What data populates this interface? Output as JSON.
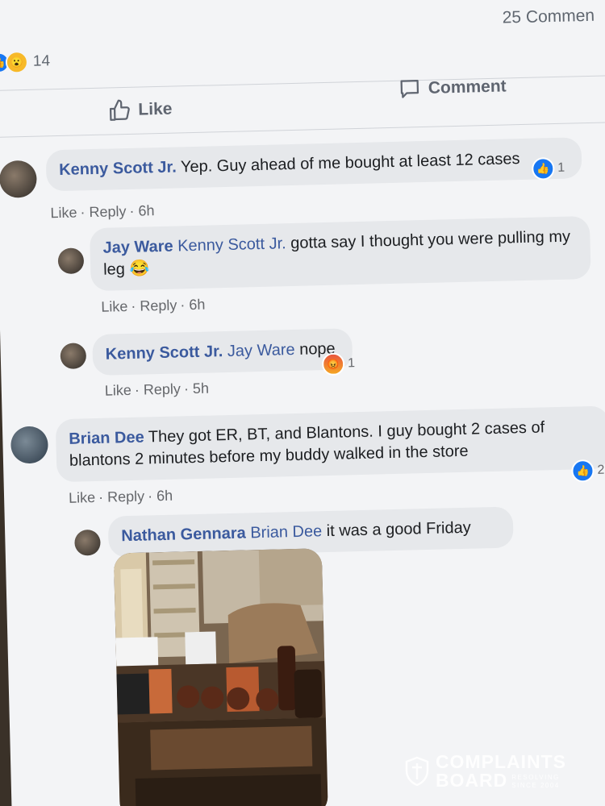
{
  "post": {
    "comment_count": "25 Commen",
    "reaction_count": "14"
  },
  "actions": {
    "like": "Like",
    "comment": "Comment"
  },
  "comments": [
    {
      "author": "Kenny Scott Jr.",
      "text": " Yep. Guy ahead of me bought at least 12 cases",
      "like": "Like",
      "reply": "Reply",
      "time": "6h",
      "reaction_count": "1"
    },
    {
      "author": "Jay Ware",
      "mention": "Kenny Scott Jr.",
      "text": " gotta say I thought you were pulling my leg ",
      "emoji": "😂",
      "like": "Like",
      "reply": "Reply",
      "time": "6h"
    },
    {
      "author": "Kenny Scott Jr.",
      "mention": "Jay Ware",
      "text": " nope",
      "like": "Like",
      "reply": "Reply",
      "time": "5h",
      "reaction_count": "1"
    },
    {
      "author": "Brian Dee",
      "text": " They got ER, BT, and Blantons. I guy bought 2 cases of blantons 2 minutes before my buddy walked in the store",
      "like": "Like",
      "reply": "Reply",
      "time": "6h",
      "reaction_count": "2"
    },
    {
      "author": "Nathan Gennara",
      "mention": "Brian Dee",
      "text": " it was a good Friday"
    }
  ],
  "watermark": {
    "line1": "COMPLAINTS",
    "line2": "BOARD",
    "tag1": "RESOLVING",
    "tag2": "SINCE 2004"
  },
  "icons": {
    "like": "thumbs-up-icon",
    "comment": "speech-bubble-icon",
    "wow": "wow-reaction-icon",
    "angry": "angry-reaction-icon"
  },
  "colors": {
    "name_link": "#3b5a9e",
    "like_blue": "#1877f2",
    "bubble": "#e6e8eb"
  }
}
